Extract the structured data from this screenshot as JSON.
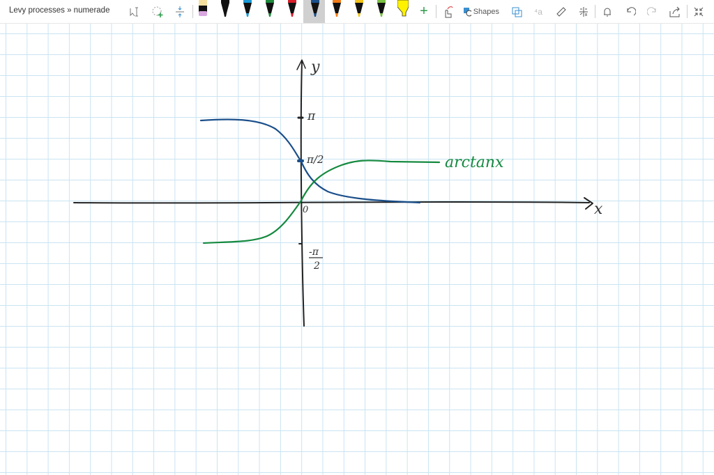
{
  "header": {
    "title": "Levy processes » numerade",
    "shapes_label": "Shapes"
  },
  "pens": [
    {
      "name": "eraser",
      "color": "#d9a7e0"
    },
    {
      "name": "black",
      "color": "#111111"
    },
    {
      "name": "blue",
      "color": "#1a9bd7"
    },
    {
      "name": "green",
      "color": "#1e8a3c"
    },
    {
      "name": "red",
      "color": "#d81e2a"
    },
    {
      "name": "dark-blue",
      "color": "#1b4f8a",
      "selected": true
    },
    {
      "name": "orange",
      "color": "#f07d1a"
    },
    {
      "name": "yellow",
      "color": "#f3c21b"
    },
    {
      "name": "lime",
      "color": "#7ac142"
    },
    {
      "name": "highlighter-yellow",
      "color": "#fff200"
    }
  ],
  "drawing": {
    "y_label": "y",
    "x_label": "x",
    "origin_label": "0",
    "pi_label": "π",
    "half_pi_label": "π/2",
    "neg_half_pi_num": "-π",
    "neg_half_pi_den": "2",
    "curve_label": "arctanx",
    "colors": {
      "axes": "#222222",
      "blue_curve": "#1b4f8a",
      "green_curve": "#14893f",
      "grid": "#c9e4f2"
    }
  }
}
